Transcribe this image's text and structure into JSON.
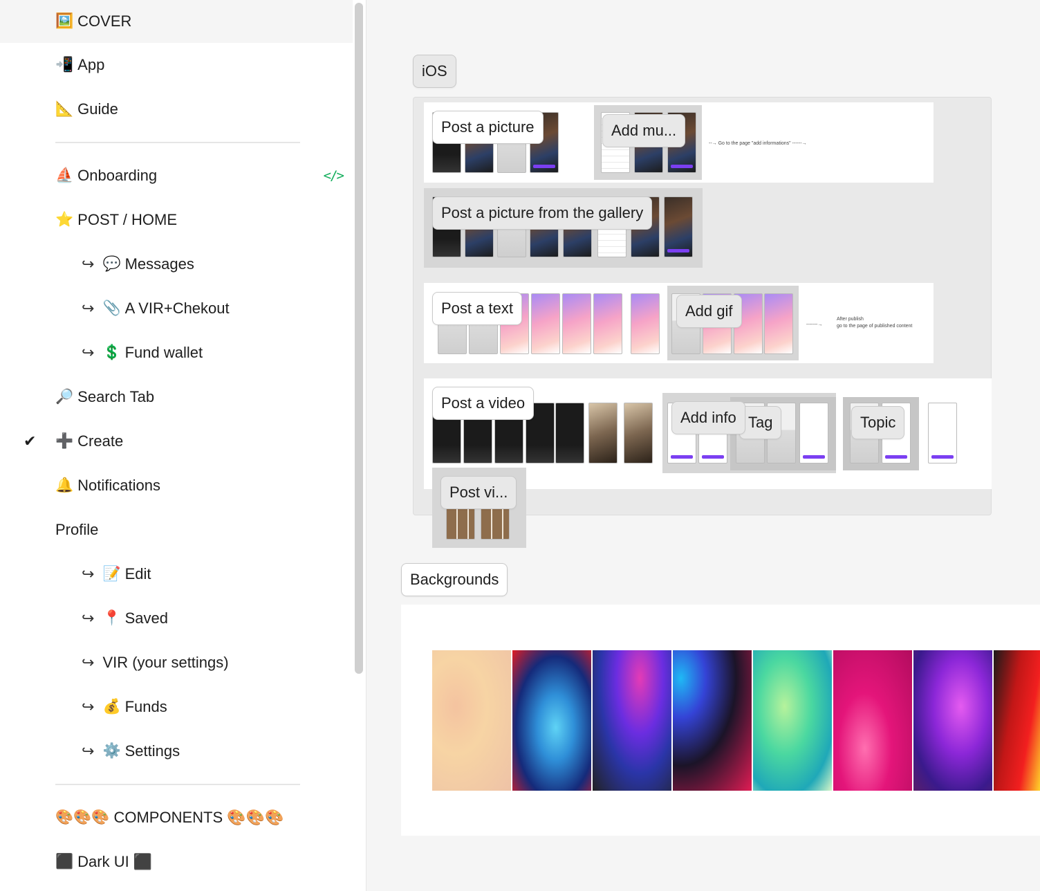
{
  "sidebar": {
    "pages": [
      {
        "emoji": "🖼️",
        "label": "COVER",
        "level": 0,
        "active": true
      },
      {
        "emoji": "📲",
        "label": "App",
        "level": 0
      },
      {
        "emoji": "📐",
        "label": "Guide",
        "level": 0
      },
      {
        "emoji": "⛵",
        "label": "Onboarding",
        "level": 0,
        "has_code": true
      },
      {
        "emoji": "⭐",
        "label": "POST / HOME",
        "level": 0
      },
      {
        "emoji": "💬",
        "label": "Messages",
        "level": 1
      },
      {
        "emoji": "📎",
        "label": "A VIR+Chekout",
        "level": 1
      },
      {
        "emoji": "💲",
        "label": "Fund wallet",
        "level": 1
      },
      {
        "emoji": "🔎",
        "label": "Search Tab",
        "level": 0
      },
      {
        "emoji": "➕",
        "label": "Create",
        "level": 0,
        "checked": true
      },
      {
        "emoji": "🔔",
        "label": "Notifications",
        "level": 0
      },
      {
        "emoji": "",
        "label": "Profile",
        "level": 0
      },
      {
        "emoji": "📝",
        "label": "Edit",
        "level": 1
      },
      {
        "emoji": "📍",
        "label": "Saved",
        "level": 1
      },
      {
        "emoji": "",
        "label": "VIR (your settings)",
        "level": 1
      },
      {
        "emoji": "💰",
        "label": "Funds",
        "level": 1
      },
      {
        "emoji": "⚙️",
        "label": "Settings",
        "level": 1
      },
      {
        "emoji": "🎨🎨🎨",
        "label": "COMPONENTS 🎨🎨🎨",
        "level": 0
      },
      {
        "emoji": "⬛",
        "label": "Dark UI ⬛",
        "level": 0
      }
    ],
    "arrow_glyph": "↪",
    "check_glyph": "✔",
    "code_glyph": "</>"
  },
  "canvas": {
    "ios_label": "iOS",
    "flows": {
      "post_picture": "Post a picture",
      "add_music": "Add mu...",
      "note_add_info": "Go to the page \"add informations\"",
      "post_gallery": "Post a picture from the gallery",
      "post_text": "Post a text",
      "add_gif": "Add gif",
      "note_after_publish_1": "After publish",
      "note_after_publish_2": "go to the page of published content",
      "post_video": "Post a video",
      "add_info": "Add info",
      "tag": "Tag",
      "topic": "Topic",
      "post_video_short": "Post vi..."
    },
    "backgrounds_label": "Backgrounds",
    "background_swatches": [
      {
        "name": "peach"
      },
      {
        "name": "red-blue"
      },
      {
        "name": "indigo"
      },
      {
        "name": "neon-dark"
      },
      {
        "name": "mint"
      },
      {
        "name": "magenta"
      },
      {
        "name": "violet"
      },
      {
        "name": "red-yellow"
      }
    ]
  },
  "colors": {
    "code_green": "#14ae5c",
    "accent_purple": "#7b3ff2"
  }
}
